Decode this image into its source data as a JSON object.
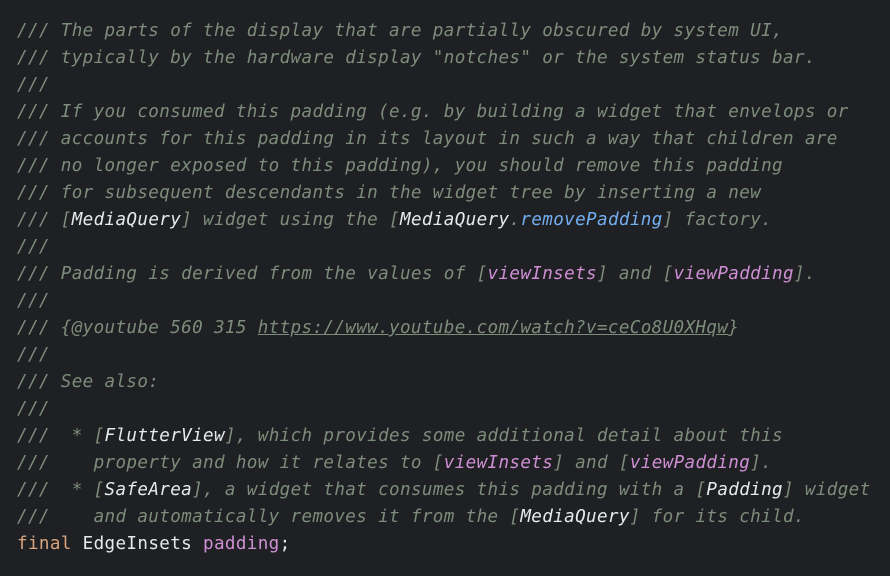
{
  "lines": [
    [
      {
        "t": "/// The parts of the display that are partially obscured by system UI,",
        "k": "c"
      }
    ],
    [
      {
        "t": "/// typically by the hardware display \"notches\" or the system status bar.",
        "k": "c"
      }
    ],
    [
      {
        "t": "///",
        "k": "c"
      }
    ],
    [
      {
        "t": "/// If you consumed this padding (e.g. by building a widget that envelops or",
        "k": "c"
      }
    ],
    [
      {
        "t": "/// accounts for this padding in its layout in such a way that children are",
        "k": "c"
      }
    ],
    [
      {
        "t": "/// no longer exposed to this padding), you should remove this padding",
        "k": "c"
      }
    ],
    [
      {
        "t": "/// for subsequent descendants in the widget tree by inserting a new",
        "k": "c"
      }
    ],
    [
      {
        "t": "/// [",
        "k": "c"
      },
      {
        "t": "MediaQuery",
        "k": "b"
      },
      {
        "t": "] widget using the [",
        "k": "c"
      },
      {
        "t": "MediaQuery",
        "k": "b"
      },
      {
        "t": ".",
        "k": "c"
      },
      {
        "t": "removePadding",
        "k": "m"
      },
      {
        "t": "] factory.",
        "k": "c"
      }
    ],
    [
      {
        "t": "///",
        "k": "c"
      }
    ],
    [
      {
        "t": "/// Padding is derived from the values of [",
        "k": "c"
      },
      {
        "t": "viewInsets",
        "k": "p"
      },
      {
        "t": "] and [",
        "k": "c"
      },
      {
        "t": "viewPadding",
        "k": "p"
      },
      {
        "t": "].",
        "k": "c"
      }
    ],
    [
      {
        "t": "///",
        "k": "c"
      }
    ],
    [
      {
        "t": "/// {@youtube 560 315 ",
        "k": "c"
      },
      {
        "t": "https://www.youtube.com/watch?v=ceCo8U0XHqw",
        "k": "u"
      },
      {
        "t": "}",
        "k": "c"
      }
    ],
    [
      {
        "t": "///",
        "k": "c"
      }
    ],
    [
      {
        "t": "/// See also:",
        "k": "c"
      }
    ],
    [
      {
        "t": "///",
        "k": "c"
      }
    ],
    [
      {
        "t": "///  * [",
        "k": "c"
      },
      {
        "t": "FlutterView",
        "k": "b"
      },
      {
        "t": "], which provides some additional detail about this",
        "k": "c"
      }
    ],
    [
      {
        "t": "///    property and how it relates to [",
        "k": "c"
      },
      {
        "t": "viewInsets",
        "k": "p"
      },
      {
        "t": "] and [",
        "k": "c"
      },
      {
        "t": "viewPadding",
        "k": "p"
      },
      {
        "t": "].",
        "k": "c"
      }
    ],
    [
      {
        "t": "///  * [",
        "k": "c"
      },
      {
        "t": "SafeArea",
        "k": "b"
      },
      {
        "t": "], a widget that consumes this padding with a [",
        "k": "c"
      },
      {
        "t": "Padding",
        "k": "b"
      },
      {
        "t": "] widget",
        "k": "c"
      }
    ],
    [
      {
        "t": "///    and automatically removes it from the [",
        "k": "c"
      },
      {
        "t": "MediaQuery",
        "k": "b"
      },
      {
        "t": "] for its child.",
        "k": "c"
      }
    ],
    [
      {
        "t": "final",
        "k": "kw"
      },
      {
        "t": " EdgeInsets ",
        "k": "ty"
      },
      {
        "t": "padding",
        "k": "vr"
      },
      {
        "t": ";",
        "k": "pl"
      }
    ]
  ],
  "colors": {
    "background": "#1f2023",
    "comment": "#7d8c7b",
    "doc_reference": "#e7e9ec",
    "method_reference": "#73aef0",
    "property_reference": "#cf8fd4",
    "keyword": "#d8a47f"
  }
}
